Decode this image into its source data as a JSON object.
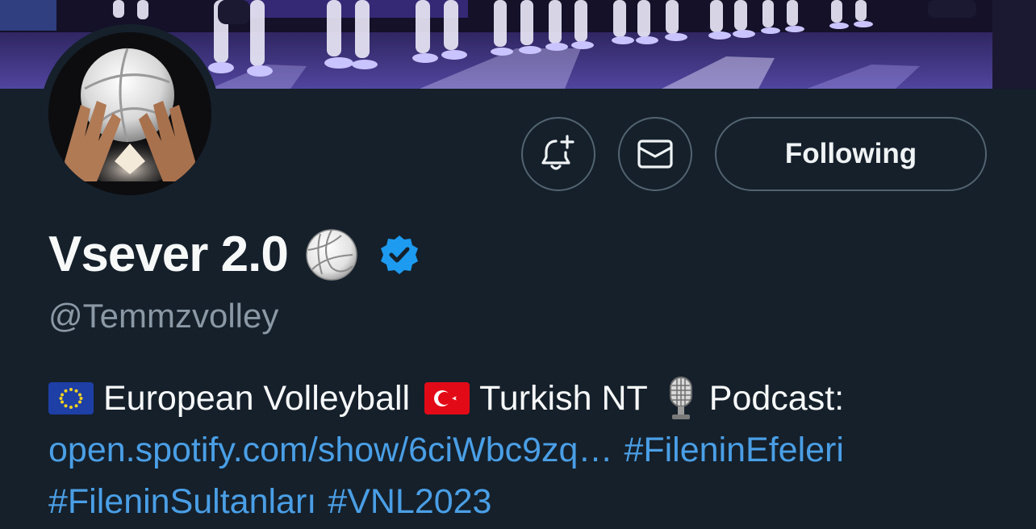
{
  "profile": {
    "display_name": "Vsever 2.0",
    "name_emoji": "volleyball-icon",
    "verified": true,
    "handle": "@Temmzvolley"
  },
  "actions": {
    "notify_icon": "bell-plus-icon",
    "message_icon": "envelope-icon",
    "follow_label": "Following"
  },
  "bio": {
    "segment_1_icon": "eu-flag-icon",
    "segment_1_text": "European Volleyball",
    "segment_2_icon": "turkey-flag-icon",
    "segment_2_text": "Turkish NT",
    "segment_3_icon": "microphone-icon",
    "segment_3_text": "Podcast:",
    "link_url": "open.spotify.com/show/6ciWbc9zq…",
    "hashtag_1": "#FileninEfeleri",
    "hashtag_2": "#FileninSultanları",
    "hashtag_3": "#VNL2023"
  },
  "colors": {
    "background": "#15202b",
    "text_primary": "#f7f9f9",
    "text_secondary": "#8b98a5",
    "link": "#4a9fe6",
    "button_border": "#536471",
    "verified_badge": "#1d9bf0"
  }
}
